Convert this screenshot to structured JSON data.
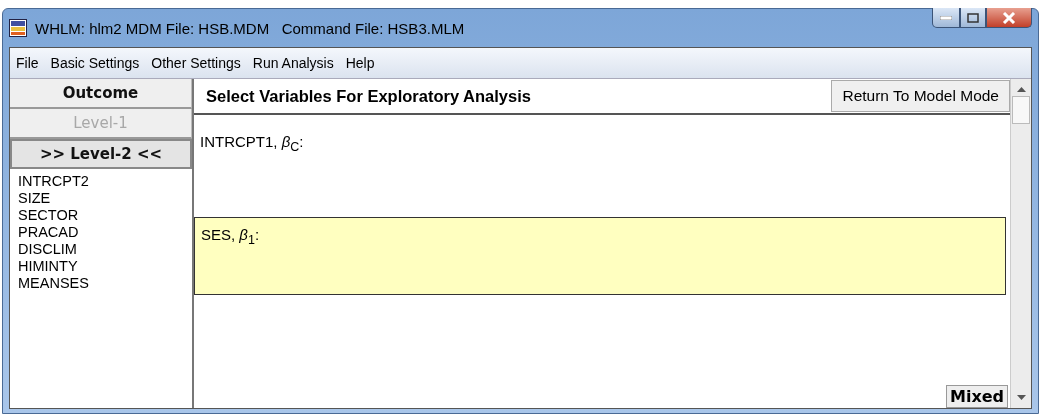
{
  "window": {
    "title": "WHLM: hlm2 MDM File: HSB.MDM   Command File: HSB3.MLM"
  },
  "menu": [
    "File",
    "Basic Settings",
    "Other Settings",
    "Run Analysis",
    "Help"
  ],
  "level_tabs": [
    {
      "label": "Outcome",
      "selected": false,
      "disabled": false
    },
    {
      "label": "Level-1",
      "selected": false,
      "disabled": true
    },
    {
      "label": ">> Level-2 <<",
      "selected": true,
      "disabled": false
    }
  ],
  "variables": [
    "INTRCPT2",
    "SIZE",
    "SECTOR",
    "PRACAD",
    "DISCLIM",
    "HIMINTY",
    "MEANSES"
  ],
  "heading": "Select Variables For Exploratory Analysis",
  "return_button": "Return To Model Mode",
  "equations": [
    {
      "text": "INTRCPT1, *β*$_{C}$:",
      "selected": false
    },
    {
      "text": "SES, *β*$_{1}$:",
      "selected": true
    }
  ],
  "mixed_button": "Mixed"
}
